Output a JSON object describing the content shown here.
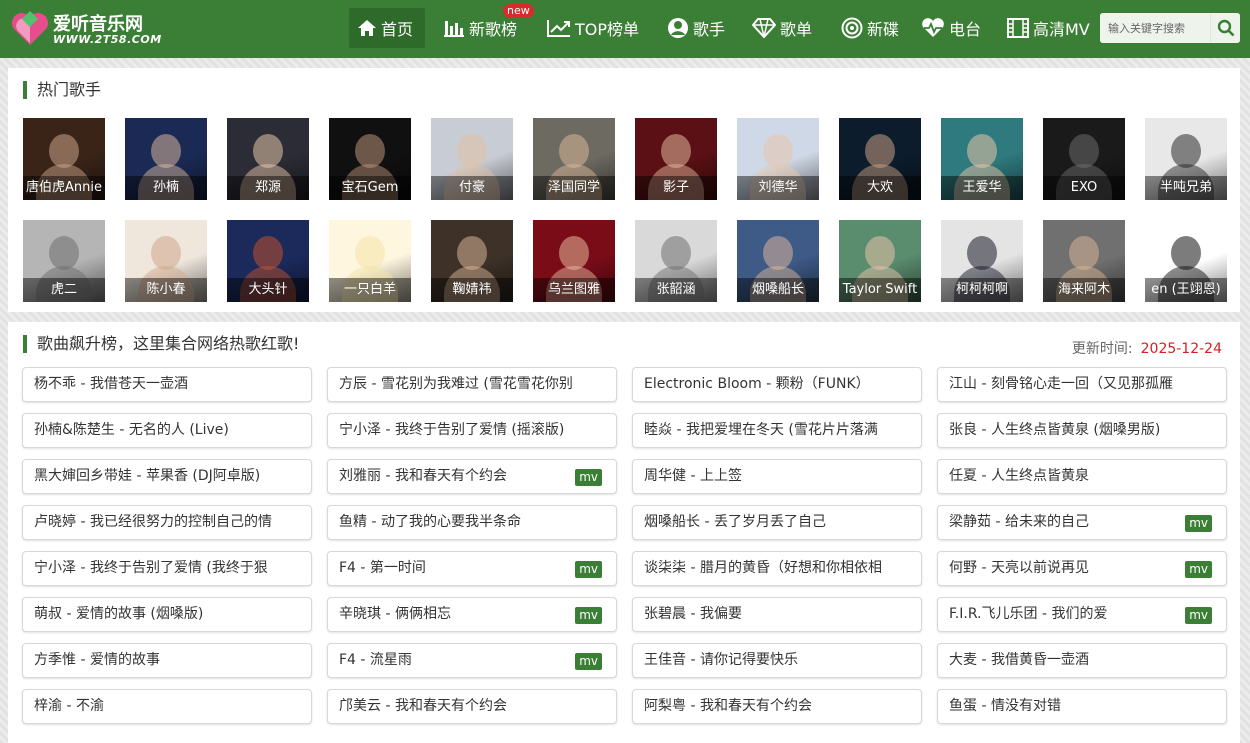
{
  "site": {
    "title": "爱听音乐网",
    "domain": "WWW.2T58.COM"
  },
  "nav": [
    {
      "label": "首页",
      "icon": "home-icon",
      "active": true
    },
    {
      "label": "新歌榜",
      "icon": "bar-chart-icon",
      "badge": "new"
    },
    {
      "label": "TOP榜单",
      "icon": "trend-line-icon"
    },
    {
      "label": "歌手",
      "icon": "user-icon"
    },
    {
      "label": "歌单",
      "icon": "diamond-icon"
    },
    {
      "label": "新碟",
      "icon": "disc-icon"
    },
    {
      "label": "电台",
      "icon": "heartbeat-icon"
    },
    {
      "label": "高清MV",
      "icon": "film-icon"
    }
  ],
  "search": {
    "placeholder": "输入关键字搜索",
    "icon": "search-icon"
  },
  "singers_section": {
    "title": "热门歌手",
    "singers": [
      "唐伯虎Annie",
      "孙楠",
      "郑源",
      "宝石Gem",
      "付豪",
      "泽国同学",
      "影子",
      "刘德华",
      "大欢",
      "王爱华",
      "EXO",
      "半吨兄弟",
      "虎二",
      "陈小春",
      "大头针",
      "一只白羊",
      "鞠婧祎",
      "乌兰图雅",
      "张韶涵",
      "烟嗓船长",
      "Taylor Swift",
      "柯柯柯啊",
      "海来阿木",
      "en (王翊恩)"
    ]
  },
  "songs_section": {
    "title": "歌曲飙升榜，这里集合网络热歌红歌!",
    "update_label": "更新时间:",
    "update_date": "2025-12-24",
    "mv_label": "mv",
    "songs": [
      {
        "title": "杨不乖 - 我借苍天一壶酒",
        "mv": false
      },
      {
        "title": "方辰 - 雪花别为我难过 (雪花雪花你别",
        "mv": false
      },
      {
        "title": "Electronic Bloom - 颗粉（FUNK）",
        "mv": false
      },
      {
        "title": "江山 - 刻骨铭心走一回（又见那孤雁",
        "mv": false
      },
      {
        "title": "孙楠&陈楚生 - 无名的人 (Live)",
        "mv": false
      },
      {
        "title": "宁小泽 - 我终于告别了爱情 (摇滚版)",
        "mv": false
      },
      {
        "title": "睦焱 - 我把爱埋在冬天 (雪花片片落满",
        "mv": false
      },
      {
        "title": "张良 - 人生终点皆黄泉 (烟嗓男版)",
        "mv": false
      },
      {
        "title": "黑大婶回乡带娃 - 苹果香 (DJ阿卓版)",
        "mv": false
      },
      {
        "title": "刘雅丽 - 我和春天有个约会",
        "mv": true
      },
      {
        "title": "周华健 - 上上签",
        "mv": false
      },
      {
        "title": "任夏 - 人生终点皆黄泉",
        "mv": false
      },
      {
        "title": "卢晓婷 - 我已经很努力的控制自己的情",
        "mv": false
      },
      {
        "title": "鱼精 - 动了我的心要我半条命",
        "mv": false
      },
      {
        "title": "烟嗓船长 - 丢了岁月丢了自己",
        "mv": false
      },
      {
        "title": "梁静茹 - 给未来的自己",
        "mv": true
      },
      {
        "title": "宁小泽 - 我终于告别了爱情 (我终于狠",
        "mv": false
      },
      {
        "title": "F4 - 第一时间",
        "mv": true
      },
      {
        "title": "谈柒柒 - 腊月的黄昏（好想和你相依相",
        "mv": false
      },
      {
        "title": "何野 - 天亮以前说再见",
        "mv": true
      },
      {
        "title": "萌叔 - 爱情的故事 (烟嗓版)",
        "mv": false
      },
      {
        "title": "辛晓琪 - 俩俩相忘",
        "mv": true
      },
      {
        "title": "张碧晨 - 我偏要",
        "mv": false
      },
      {
        "title": "F.I.R.飞儿乐团 - 我们的爱",
        "mv": true
      },
      {
        "title": "方季惟 - 爱情的故事",
        "mv": false
      },
      {
        "title": "F4 - 流星雨",
        "mv": true
      },
      {
        "title": "王佳音 - 请你记得要快乐",
        "mv": false
      },
      {
        "title": "大麦 - 我借黄昏一壶酒",
        "mv": false
      },
      {
        "title": "梓渝 - 不渝",
        "mv": false
      },
      {
        "title": "邝美云 - 我和春天有个约会",
        "mv": false
      },
      {
        "title": "阿梨粤 - 我和春天有个约会",
        "mv": false
      },
      {
        "title": "鱼蛋 - 情没有对错",
        "mv": false
      }
    ]
  },
  "colors": {
    "brand_green": "#3b7e35",
    "date_red": "#d32020",
    "badge_red": "#d92b2b"
  }
}
